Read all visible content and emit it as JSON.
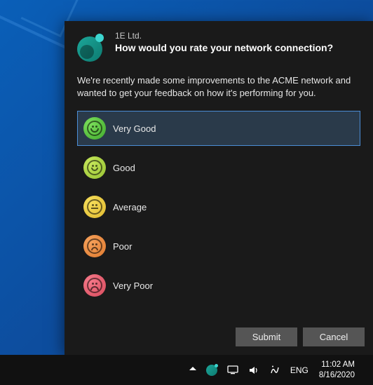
{
  "dialog": {
    "vendor": "1E Ltd.",
    "title": "How would you rate your network connection?",
    "description": "We're recently made some improvements to the ACME network and wanted to get your feedback on how it's performing for you.",
    "options": [
      {
        "label": "Very Good",
        "sentiment": "very-good",
        "mouth": "smile-big",
        "selected": true
      },
      {
        "label": "Good",
        "sentiment": "good",
        "mouth": "smile",
        "selected": false
      },
      {
        "label": "Average",
        "sentiment": "average",
        "mouth": "flat",
        "selected": false
      },
      {
        "label": "Poor",
        "sentiment": "poor",
        "mouth": "frown",
        "selected": false
      },
      {
        "label": "Very Poor",
        "sentiment": "very-poor",
        "mouth": "frown-big",
        "selected": false
      }
    ],
    "submit_label": "Submit",
    "cancel_label": "Cancel"
  },
  "taskbar": {
    "language": "ENG",
    "time": "11:02 AM",
    "date": "8/16/2020"
  }
}
